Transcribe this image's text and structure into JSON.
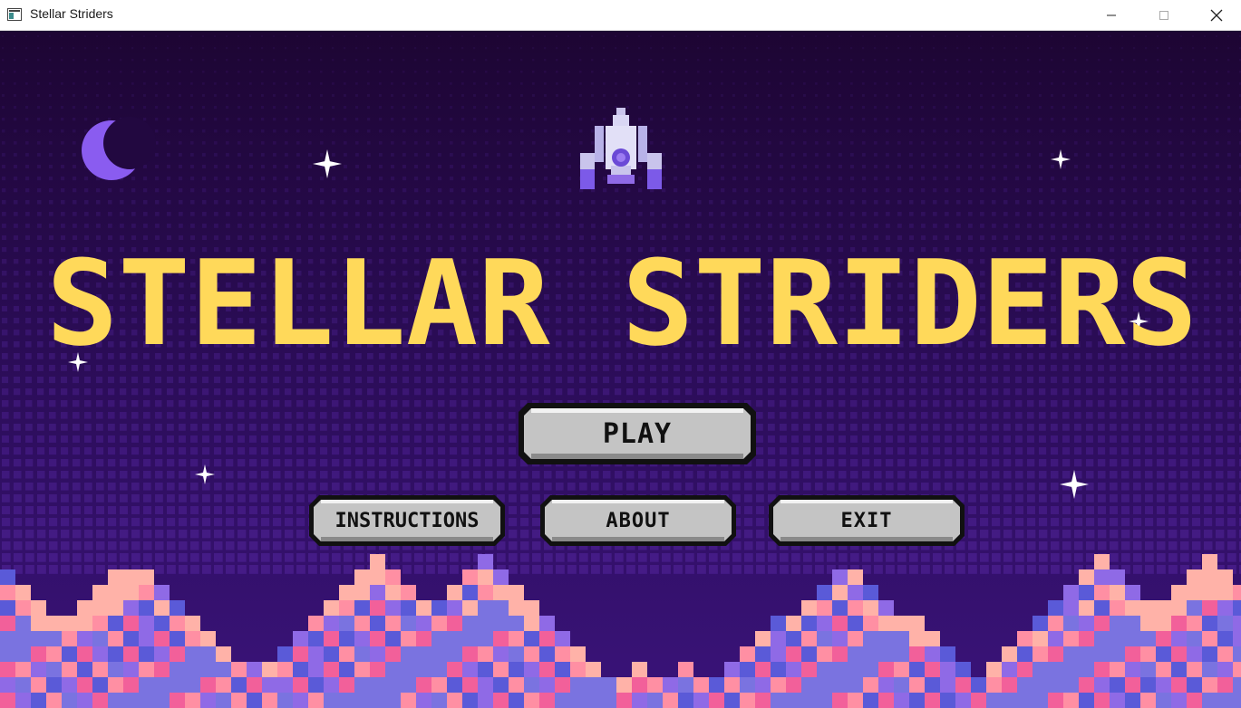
{
  "window": {
    "title": "Stellar Striders",
    "controls": {
      "minimize": "minimize-icon",
      "maximize": "maximize-icon",
      "close": "close-icon"
    }
  },
  "game": {
    "title": "STELLAR STRIDERS",
    "menu": {
      "play_label": "PLAY",
      "instructions_label": "INSTRUCTIONS",
      "about_label": "ABOUT",
      "exit_label": "EXIT"
    },
    "decor": [
      "moon-icon",
      "spaceship-icon",
      "star-icon",
      "pixel-mountains"
    ],
    "colors": {
      "sky_top": "#1d0533",
      "sky_bottom": "#3a137a",
      "title_yellow": "#ffd95a",
      "moon": "#8a5cf0",
      "button_fill": "#c4c4c4",
      "mountain_blue": "#5a5ad8",
      "mountain_purple": "#8f6ae6",
      "mountain_pink": "#ff8fa3"
    }
  }
}
